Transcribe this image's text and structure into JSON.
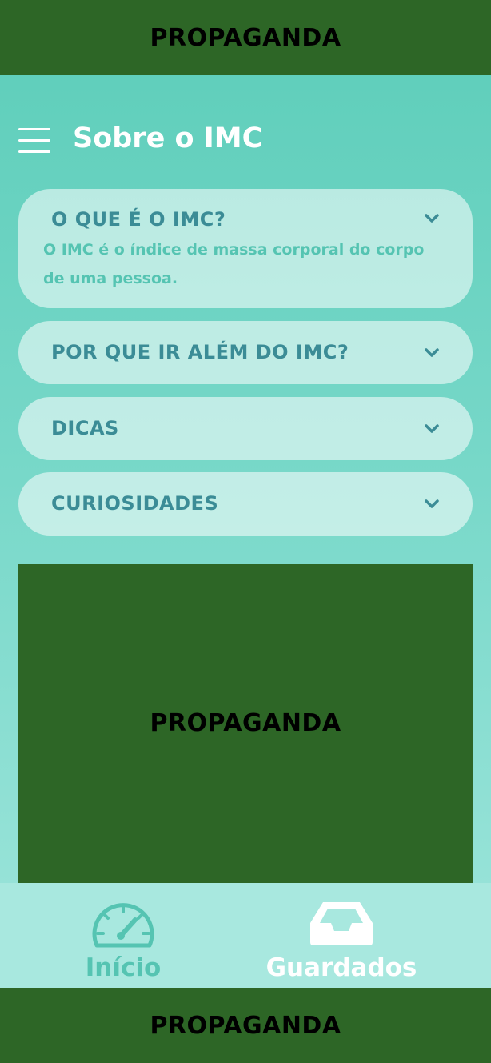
{
  "ads": {
    "top": "PROPAGANDA",
    "middle": "PROPAGANDA",
    "bottom": "PROPAGANDA"
  },
  "header": {
    "title": "Sobre o IMC",
    "menu_icon": "hamburger-icon"
  },
  "accordion": [
    {
      "title": "O QUE É O IMC?",
      "expanded": true,
      "body": "O IMC é o índice de massa corporal do corpo de uma pessoa."
    },
    {
      "title": "POR QUE IR ALÉM DO IMC?",
      "expanded": false
    },
    {
      "title": "DICAS",
      "expanded": false
    },
    {
      "title": "CURIOSIDADES",
      "expanded": false
    }
  ],
  "bottom_nav": {
    "items": [
      {
        "label": "Início",
        "icon": "speedometer-icon",
        "active": true
      },
      {
        "label": "Guardados",
        "icon": "inbox-icon",
        "active": false
      }
    ]
  },
  "colors": {
    "ad_green": "#2d6626",
    "card_title": "#3b8c96",
    "accent_teal": "#55c4b2",
    "white": "#ffffff"
  }
}
